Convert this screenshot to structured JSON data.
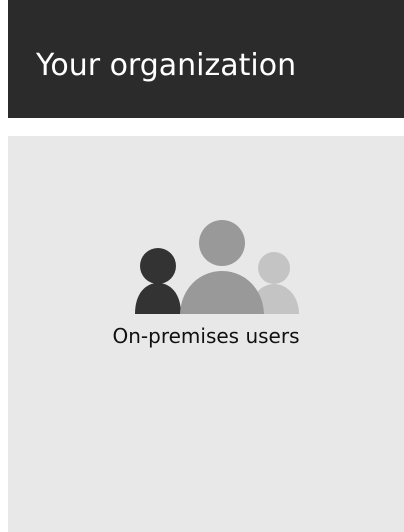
{
  "header": {
    "title": "Your organization"
  },
  "panel": {
    "label": "On-premises users",
    "icon": "users-icon",
    "colors": {
      "background": "#e8e8e8",
      "user_dark": "#333333",
      "user_mid": "#999999",
      "user_light": "#c4c4c4"
    }
  }
}
